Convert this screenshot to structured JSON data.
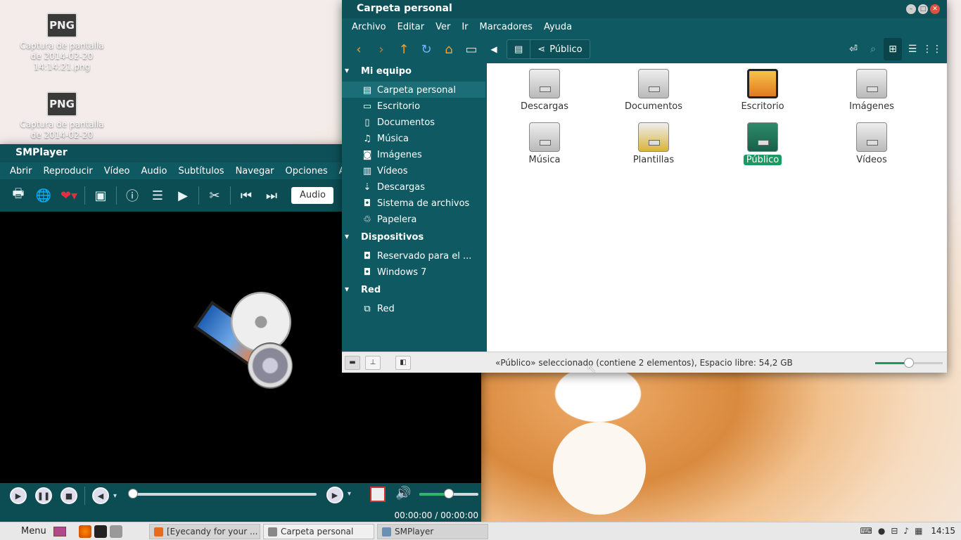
{
  "desktop": {
    "icons": [
      {
        "badge": "PNG",
        "label": "Captura de pantalla de 2014-02-20 14:14:21.png"
      },
      {
        "badge": "PNG",
        "label": "Captura de pantalla de 2014-02-20"
      }
    ]
  },
  "smplayer": {
    "title": "SMPlayer",
    "menu": [
      "Abrir",
      "Reproducir",
      "Vídeo",
      "Audio",
      "Subtítulos",
      "Navegar",
      "Opciones",
      "A"
    ],
    "audio_label": "Audio",
    "time": "00:00:00 / 00:00:00",
    "seek_position": 0,
    "volume_level": 0.5
  },
  "file_manager": {
    "title": "Carpeta personal",
    "menu": [
      "Archivo",
      "Editar",
      "Ver",
      "Ir",
      "Marcadores",
      "Ayuda"
    ],
    "path": [
      "Público"
    ],
    "sidebar": {
      "sections": [
        {
          "title": "Mi equipo",
          "items": [
            {
              "label": "Carpeta personal",
              "icon": "home-folder-icon",
              "selected": true
            },
            {
              "label": "Escritorio",
              "icon": "desktop-icon"
            },
            {
              "label": "Documentos",
              "icon": "document-icon"
            },
            {
              "label": "Música",
              "icon": "music-icon"
            },
            {
              "label": "Imágenes",
              "icon": "camera-icon"
            },
            {
              "label": "Vídeos",
              "icon": "film-icon"
            },
            {
              "label": "Descargas",
              "icon": "download-icon"
            },
            {
              "label": "Sistema de archivos",
              "icon": "drive-icon"
            },
            {
              "label": "Papelera",
              "icon": "trash-icon"
            }
          ]
        },
        {
          "title": "Dispositivos",
          "items": [
            {
              "label": "Reservado para el ...",
              "icon": "drive-icon"
            },
            {
              "label": "Windows 7",
              "icon": "drive-icon"
            }
          ]
        },
        {
          "title": "Red",
          "items": [
            {
              "label": "Red",
              "icon": "network-icon"
            }
          ]
        }
      ]
    },
    "files": [
      {
        "label": "Descargas",
        "icon": "downloads-folder-icon"
      },
      {
        "label": "Documentos",
        "icon": "documents-folder-icon"
      },
      {
        "label": "Escritorio",
        "icon": "desktop-folder-icon"
      },
      {
        "label": "Imágenes",
        "icon": "pictures-folder-icon"
      },
      {
        "label": "Música",
        "icon": "music-folder-icon"
      },
      {
        "label": "Plantillas",
        "icon": "templates-folder-icon"
      },
      {
        "label": "Público",
        "icon": "public-folder-icon",
        "selected": true
      },
      {
        "label": "Vídeos",
        "icon": "videos-folder-icon"
      }
    ],
    "status": "«Público» seleccionado (contiene 2 elementos), Espacio libre: 54,2 GB",
    "zoom_level": 0.5
  },
  "taskbar": {
    "menu_label": "Menu",
    "tasks": [
      {
        "label": "[Eyecandy for your ..."
      },
      {
        "label": "Carpeta personal"
      },
      {
        "label": "SMPlayer"
      }
    ],
    "clock": "14:15"
  },
  "colors": {
    "accent": "#0f5a62",
    "selected": "#1a9a63",
    "close": "#e05040"
  }
}
